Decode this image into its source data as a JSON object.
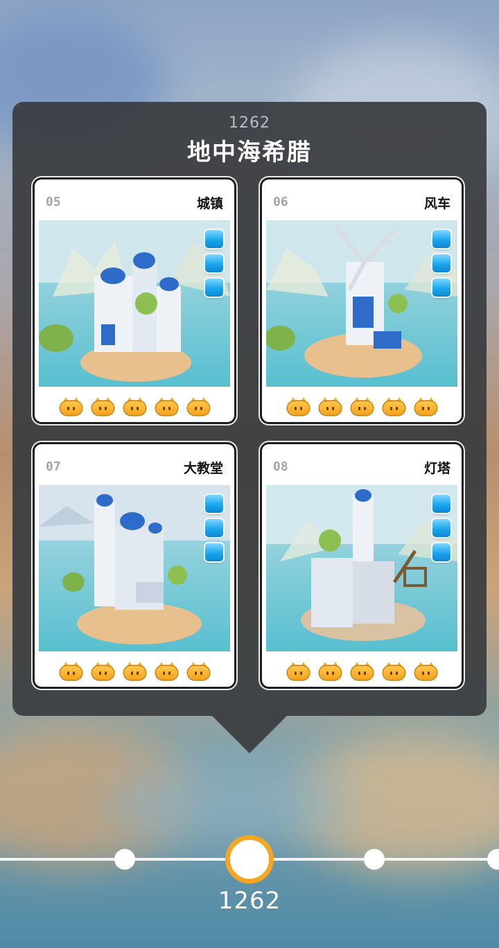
{
  "region": {
    "year": "1262",
    "title": "地中海希腊"
  },
  "levels": [
    {
      "number": "05",
      "name": "城镇",
      "pieces_collected": 3,
      "cats": 5
    },
    {
      "number": "06",
      "name": "风车",
      "pieces_collected": 3,
      "cats": 5
    },
    {
      "number": "07",
      "name": "大教堂",
      "pieces_collected": 3,
      "cats": 5
    },
    {
      "number": "08",
      "name": "灯塔",
      "pieces_collected": 3,
      "cats": 5
    }
  ],
  "timeline": {
    "current_year": "1262"
  },
  "colors": {
    "panel": "#3a3c40",
    "accent_orange": "#f5a623",
    "piece_blue": "#1ca6ee",
    "cat_orange": "#f3a21b"
  },
  "icons": {
    "piece": "puzzle-piece-icon",
    "cat": "cat-face-icon",
    "node": "timeline-node-icon"
  }
}
